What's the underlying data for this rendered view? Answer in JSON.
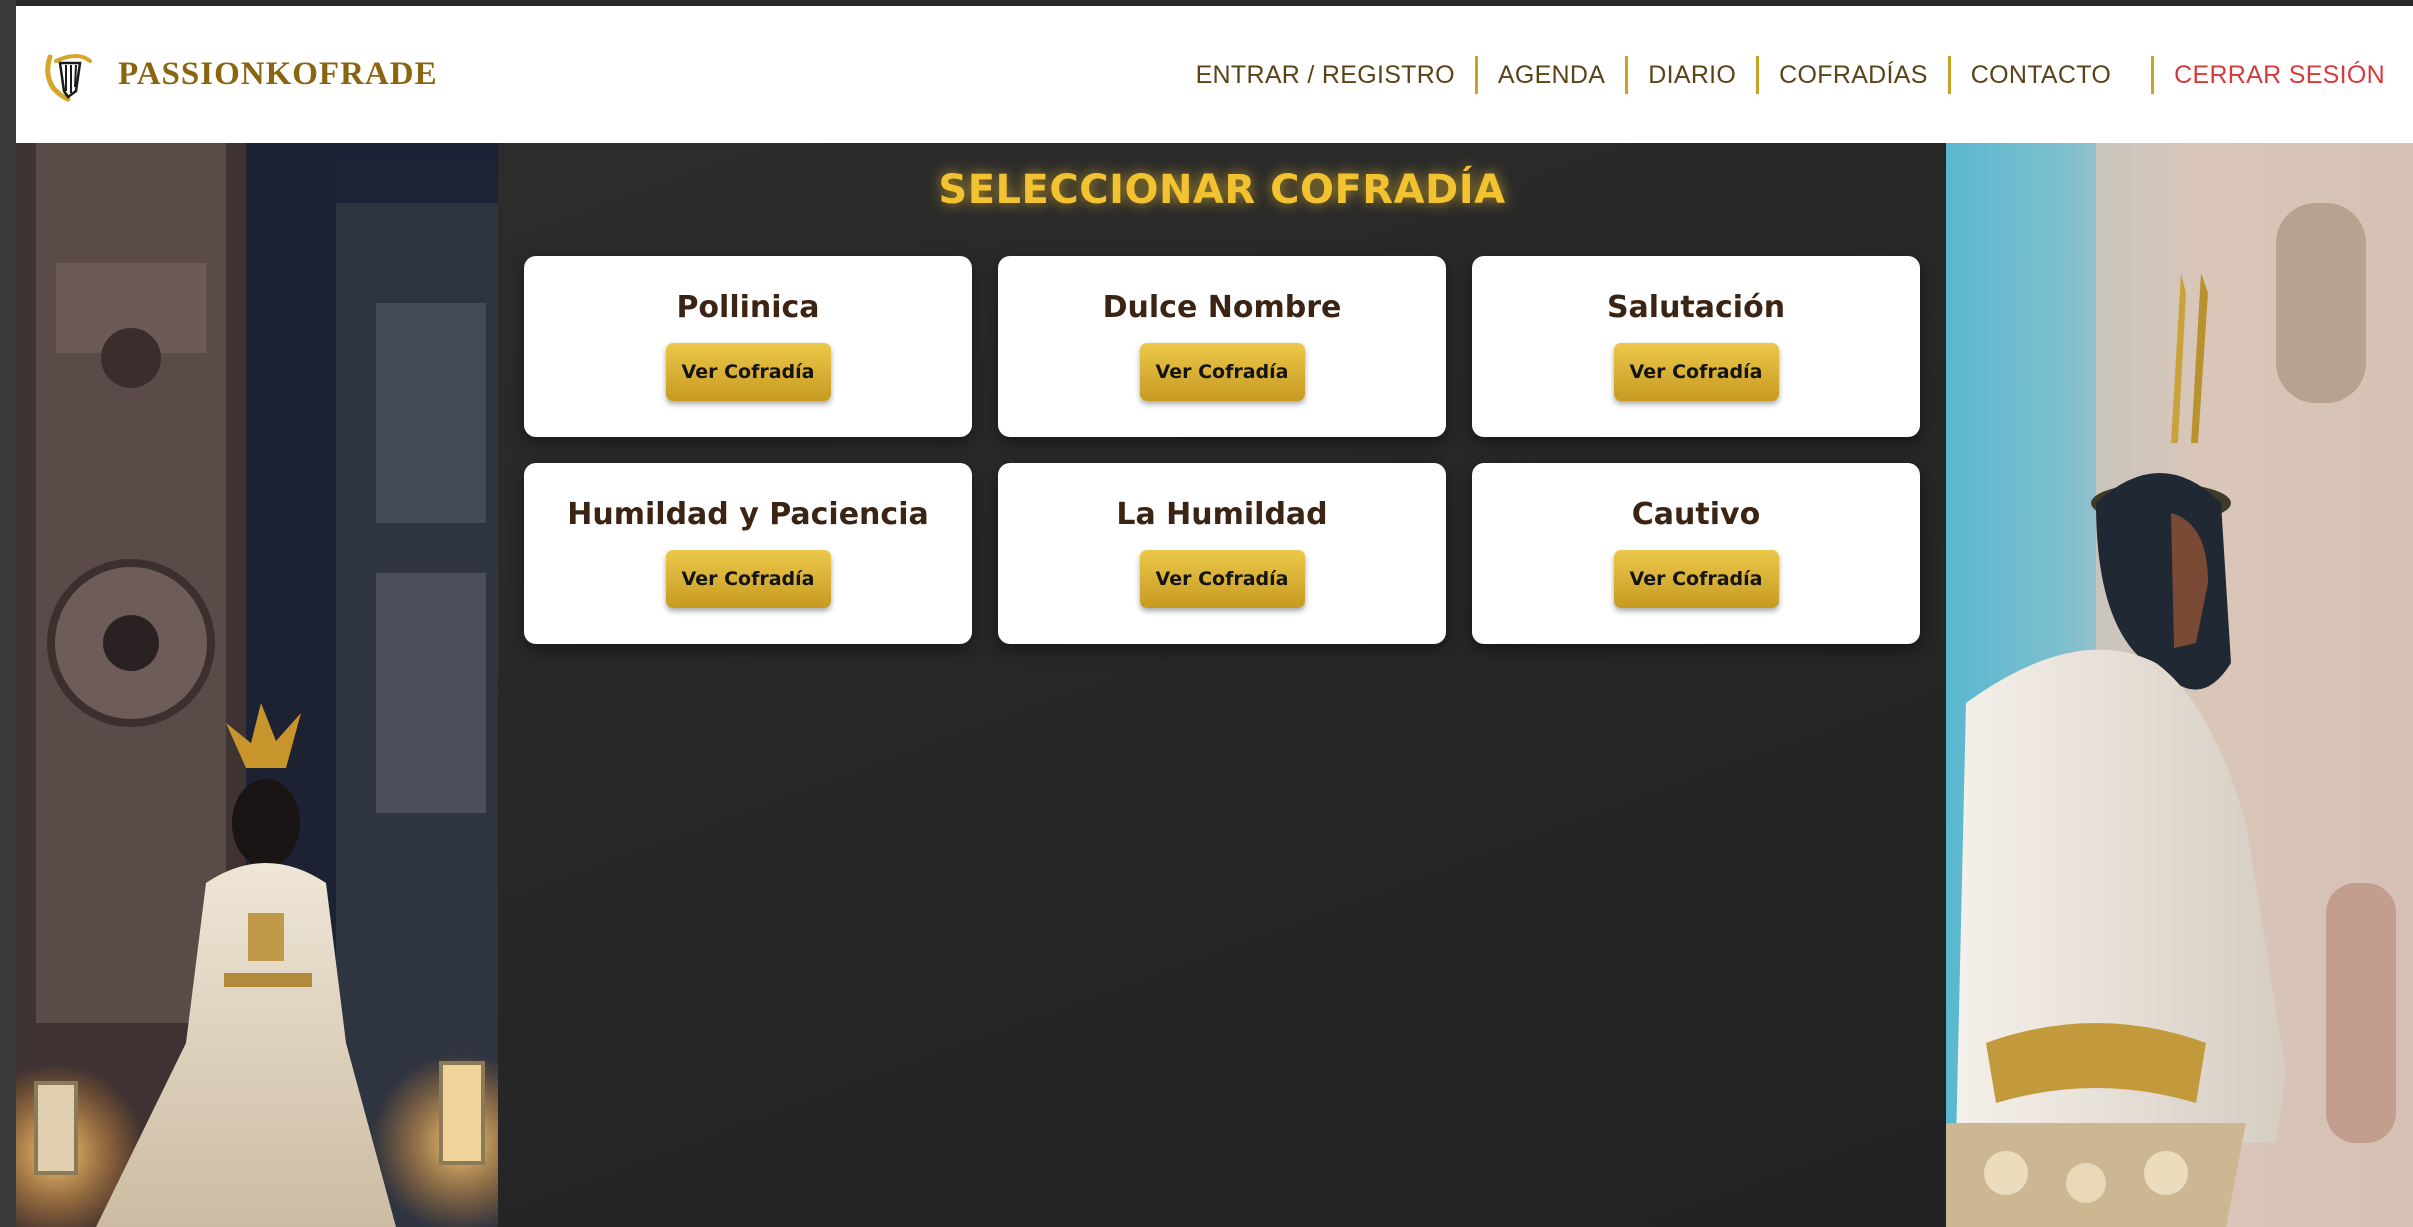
{
  "brand": {
    "name": "PASSIONKOFRADE"
  },
  "nav": {
    "items": [
      {
        "label": "ENTRAR / REGISTRO"
      },
      {
        "label": "AGENDA"
      },
      {
        "label": "DIARIO"
      },
      {
        "label": "COFRADÍAS"
      },
      {
        "label": "CONTACTO"
      }
    ],
    "logout": "CERRAR SESIÓN"
  },
  "main": {
    "title": "SELECCIONAR COFRADÍA",
    "cards": [
      {
        "name": "Pollinica",
        "button": "Ver Cofradía"
      },
      {
        "name": "Dulce Nombre",
        "button": "Ver Cofradía"
      },
      {
        "name": "Salutación",
        "button": "Ver Cofradía"
      },
      {
        "name": "Humildad y Paciencia",
        "button": "Ver Cofradía"
      },
      {
        "name": "La Humildad",
        "button": "Ver Cofradía"
      },
      {
        "name": "Cautivo",
        "button": "Ver Cofradía"
      }
    ]
  },
  "colors": {
    "accent_gold": "#f2c230",
    "button_gold": "#d9b136",
    "logout_red": "#d43c3c",
    "nav_text": "#5a4318",
    "card_text": "#3b2413"
  },
  "icons": {
    "logo": "cofrade-logo-icon"
  }
}
